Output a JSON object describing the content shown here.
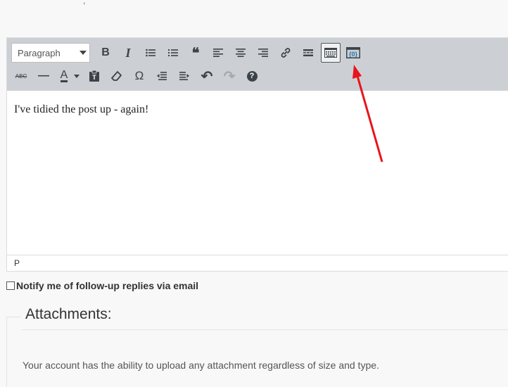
{
  "toolbar": {
    "format_select": "Paragraph",
    "row1": [
      {
        "name": "bold-icon",
        "glyph": "B"
      },
      {
        "name": "italic-icon",
        "glyph": "I"
      },
      {
        "name": "bulleted-list-icon"
      },
      {
        "name": "numbered-list-icon"
      },
      {
        "name": "blockquote-icon",
        "glyph": "❝"
      },
      {
        "name": "align-left-icon"
      },
      {
        "name": "align-center-icon"
      },
      {
        "name": "align-right-icon"
      },
      {
        "name": "insert-link-icon"
      },
      {
        "name": "read-more-icon"
      },
      {
        "name": "toolbar-toggle-icon",
        "active": true
      },
      {
        "name": "code-block-icon",
        "accent": "#2271b1"
      }
    ],
    "row2": [
      {
        "name": "strikethrough-icon",
        "glyph": "ABC"
      },
      {
        "name": "horizontal-line-icon",
        "glyph": "—"
      },
      {
        "name": "text-color-icon",
        "glyph": "A"
      },
      {
        "name": "paste-as-text-icon"
      },
      {
        "name": "clear-formatting-icon"
      },
      {
        "name": "special-character-icon",
        "glyph": "Ω"
      },
      {
        "name": "outdent-icon"
      },
      {
        "name": "indent-icon"
      },
      {
        "name": "undo-icon",
        "glyph": "↶"
      },
      {
        "name": "redo-icon",
        "glyph": "↷",
        "disabled": true
      },
      {
        "name": "help-icon",
        "glyph": "?"
      }
    ]
  },
  "editor": {
    "content": "I've tidied the post up - again!",
    "path": "P"
  },
  "notify_label": "Notify me of follow-up replies via email",
  "attachments": {
    "title": "Attachments:",
    "note": "Your account has the ability to upload any attachment regardless of size and type."
  },
  "annotation": {
    "color": "#e8141b"
  }
}
